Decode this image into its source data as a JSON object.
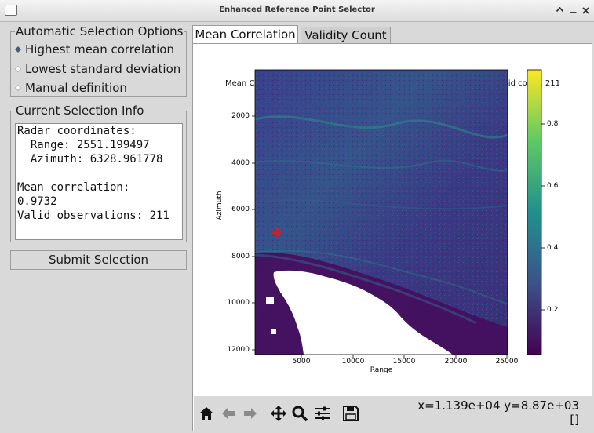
{
  "window": {
    "title": "Enhanced Reference Point Selector",
    "buttons": [
      "^",
      "_",
      "x"
    ]
  },
  "options": {
    "title": "Automatic Selection Options",
    "items": [
      {
        "label": "Highest mean correlation",
        "selected": true
      },
      {
        "label": "Lowest standard deviation",
        "selected": false
      },
      {
        "label": "Manual definition",
        "selected": false
      }
    ]
  },
  "info": {
    "title": "Current Selection Info",
    "text": "Radar coordinates:\n  Range: 2551.199497\n  Azimuth: 6328.961778\n\nMean correlation:\n0.9732\nValid observations: 211"
  },
  "submit_label": "Submit Selection",
  "tabs": [
    {
      "label": "Mean Correlation",
      "active": true
    },
    {
      "label": "Validity Count",
      "active": false
    }
  ],
  "plot": {
    "title": "Mean Correlation - Range: 11388.47, Azimuth: 8870.22, Corr: 0.317, Valid count: 211",
    "xlabel": "Range",
    "ylabel": "Azimuth",
    "xticks": [
      "5000",
      "10000",
      "15000",
      "20000",
      "25000"
    ],
    "yticks": [
      "2000",
      "4000",
      "6000",
      "8000",
      "10000",
      "12000"
    ],
    "colorbar_ticks": [
      "0.8",
      "0.6",
      "0.4",
      "0.2"
    ],
    "colormap": "viridis",
    "marker": {
      "range": 2551.2,
      "azimuth": 6329,
      "color": "#e8141c",
      "symbol": "+"
    }
  },
  "toolbar": {
    "icons": [
      "home-icon",
      "back-icon",
      "forward-icon",
      "pan-icon",
      "zoom-icon",
      "configure-icon",
      "save-icon"
    ],
    "coords_line1": "x=1.139e+04 y=8.87e+03",
    "coords_line2": "[]"
  }
}
